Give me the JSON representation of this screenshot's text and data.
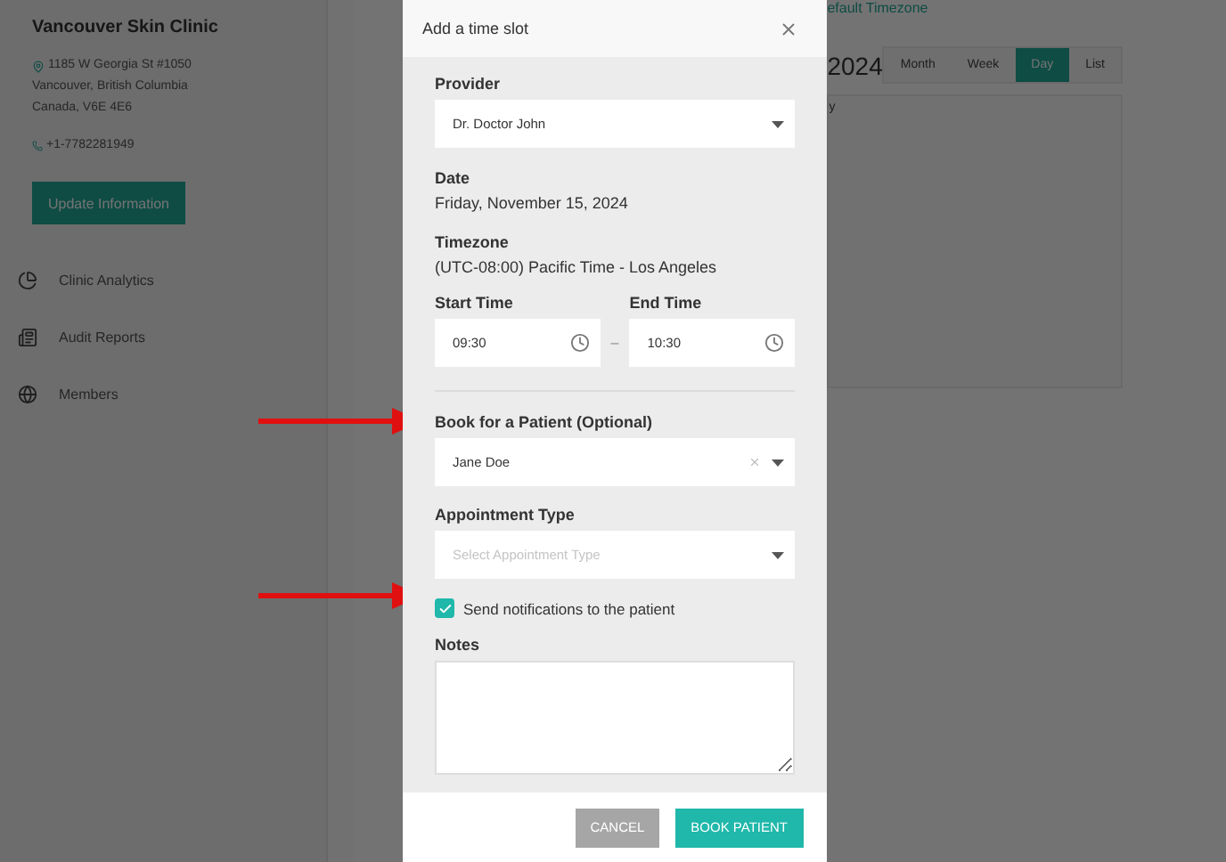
{
  "sidebar": {
    "clinic_name": "Vancouver Skin Clinic",
    "address_lines": [
      "1185 W Georgia St #1050",
      "Vancouver, British Columbia",
      "Canada, V6E 4E6"
    ],
    "phone": "+1-7782281949",
    "update_button": "Update Information",
    "menu": [
      {
        "label": "Clinic Analytics",
        "kind": "analytics"
      },
      {
        "label": "Audit Reports",
        "kind": "reports"
      },
      {
        "label": "Members",
        "kind": "members"
      }
    ]
  },
  "main": {
    "link": "efault Timezone",
    "title": "2024",
    "column_1": "y",
    "view_tabs": [
      {
        "label": "Month",
        "selected": false
      },
      {
        "label": "Week",
        "selected": false
      },
      {
        "label": "Day",
        "selected": true
      },
      {
        "label": "List",
        "selected": false
      }
    ]
  },
  "dialog": {
    "title": "Add a time slot",
    "provider": {
      "label": "Provider",
      "value": "Dr. Doctor John"
    },
    "date": {
      "label": "Date",
      "value": "Friday, November 15, 2024"
    },
    "timezone": {
      "label": "Timezone",
      "value": "(UTC-08:00) Pacific Time - Los Angeles"
    },
    "start_time": {
      "label": "Start Time",
      "value": "09:30"
    },
    "separator": "–",
    "end_time": {
      "label": "End Time",
      "value": "10:30"
    },
    "patient": {
      "label": "Book for a Patient (Optional)",
      "value": "Jane Doe"
    },
    "appointment_type": {
      "label": "Appointment Type",
      "placeholder": "Select Appointment Type"
    },
    "notify": {
      "label": "Send notifications to the patient",
      "checked": true
    },
    "notes": {
      "label": "Notes"
    },
    "buttons": [
      {
        "label": "CANCEL",
        "kind": "secondary"
      },
      {
        "label": "BOOK PATIENT",
        "kind": "primary"
      }
    ]
  }
}
